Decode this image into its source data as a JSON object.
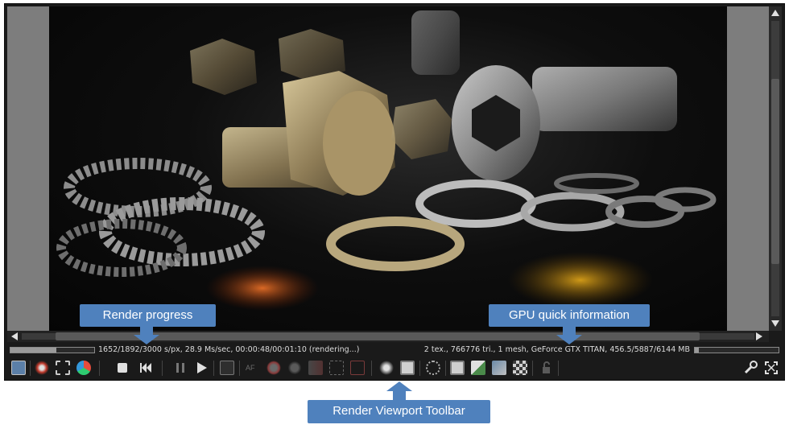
{
  "app": {
    "status": {
      "left_text": "1652/1892/3000 s/px, 28.9 Ms/sec, 00:00:48/00:01:10 (rendering...)",
      "right_text": "2 tex., 766776 tri., 1 mesh, GeForce GTX TITAN, 456.5/5887/6144 MB",
      "render_progress": 0.55,
      "gpu_memory_used": 0.05
    },
    "toolbar": {
      "left_icons": [
        "save-render-icon",
        "reset-camera-icon",
        "region-render-icon",
        "material-picker-icon",
        "stop-render-icon",
        "restart-render-icon",
        "pause-render-icon",
        "start-render-icon",
        "viewport-settings-icon",
        "aperture-focus-icon",
        "white-balance-icon",
        "material-focus-icon",
        "film-region-icon",
        "object-picker-icon",
        "render-priority-icon",
        "camera-view-icon",
        "display-mode-icon",
        "clay-mode-icon",
        "subsampling-icon",
        "lock-icon"
      ],
      "right_icons": [
        "wrench-icon",
        "fullscreen-icon"
      ]
    },
    "viewport": {
      "image": "rendered scene of bolts, nuts and washers"
    }
  },
  "callouts": {
    "render_progress": "Render progress",
    "gpu_info": "GPU quick information",
    "render_toolbar": "Render Viewport Toolbar"
  },
  "colors": {
    "callout": "#4f81bd",
    "app_bg": "#1a1a1a",
    "viewport_border": "#7d7d7d"
  }
}
